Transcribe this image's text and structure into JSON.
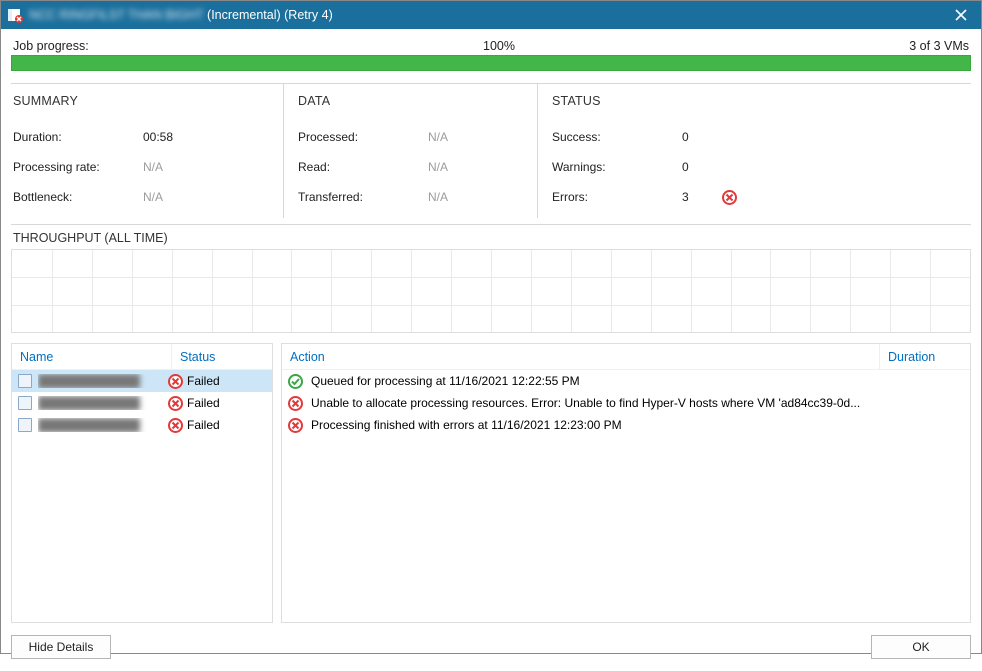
{
  "title": {
    "prefix_blur": "NCC RINGFILST THAN BIGHT",
    "suffix": " (Incremental) (Retry 4)"
  },
  "progress": {
    "label": "Job progress:",
    "percent_text": "100%",
    "counter": "3 of 3 VMs"
  },
  "summary": {
    "heading": "SUMMARY",
    "rows": [
      {
        "label": "Duration:",
        "value": "00:58",
        "na": false
      },
      {
        "label": "Processing rate:",
        "value": "N/A",
        "na": true
      },
      {
        "label": "Bottleneck:",
        "value": "N/A",
        "na": true
      }
    ]
  },
  "data_section": {
    "heading": "DATA",
    "rows": [
      {
        "label": "Processed:",
        "value": "N/A",
        "na": true
      },
      {
        "label": "Read:",
        "value": "N/A",
        "na": true
      },
      {
        "label": "Transferred:",
        "value": "N/A",
        "na": true
      }
    ]
  },
  "status_section": {
    "heading": "STATUS",
    "rows": [
      {
        "label": "Success:",
        "value": "0",
        "error_icon": false
      },
      {
        "label": "Warnings:",
        "value": "0",
        "error_icon": false
      },
      {
        "label": "Errors:",
        "value": "3",
        "error_icon": true
      }
    ]
  },
  "throughput": {
    "heading": "THROUGHPUT (ALL TIME)"
  },
  "left_panel": {
    "columns": {
      "name": "Name",
      "status": "Status"
    },
    "rows": [
      {
        "name_blur": "████████████",
        "status": "Failed",
        "selected": true
      },
      {
        "name_blur": "████████████",
        "status": "Failed",
        "selected": false
      },
      {
        "name_blur": "████████████",
        "status": "Failed",
        "selected": false
      }
    ]
  },
  "right_panel": {
    "columns": {
      "action": "Action",
      "duration": "Duration"
    },
    "rows": [
      {
        "icon": "success",
        "text": "Queued for processing at 11/16/2021 12:22:55 PM",
        "duration": ""
      },
      {
        "icon": "error",
        "text": "Unable to allocate processing resources. Error: Unable to find Hyper-V hosts where VM 'ad84cc39-0d...",
        "duration": ""
      },
      {
        "icon": "error",
        "text": "Processing finished with errors at 11/16/2021 12:23:00 PM",
        "duration": ""
      }
    ]
  },
  "buttons": {
    "hide_details": "Hide Details",
    "ok": "OK"
  }
}
